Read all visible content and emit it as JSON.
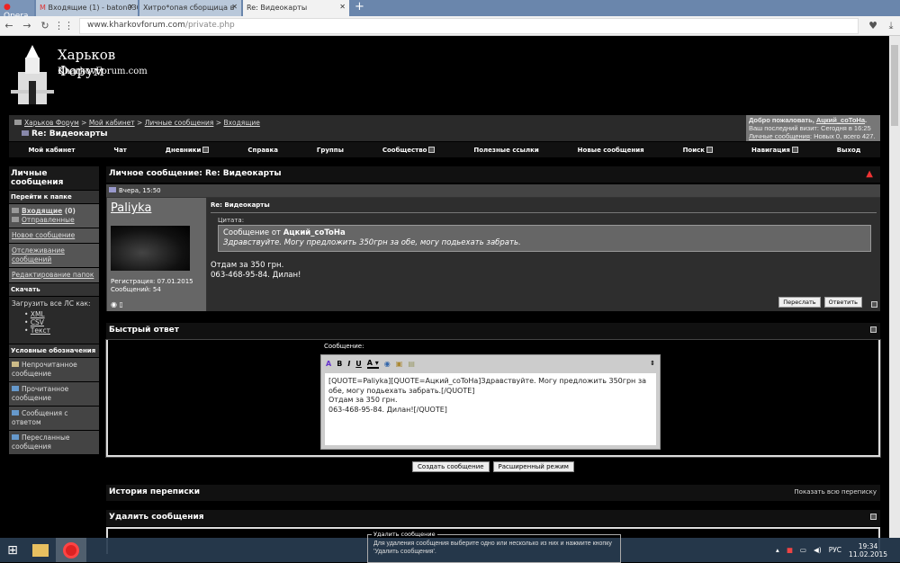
{
  "browser": {
    "opera_label": "Opera",
    "tabs": [
      {
        "label": "Входящие (1) - baton030"
      },
      {
        "label": "Хитро*опая сборщица в"
      },
      {
        "label": "Re: Видеокарты"
      }
    ],
    "url_host": "www.kharkovforum.com",
    "url_path": "/private.php"
  },
  "logo": {
    "title": "Харьков Форум",
    "subtitle": "KharkovForum.com"
  },
  "breadcrumb": {
    "items": [
      "Харьков Форум",
      "Мой кабинет",
      "Личные сообщения",
      "Входящие"
    ],
    "sep": " > ",
    "title": "Re: Видеокарты"
  },
  "welcome": {
    "line1": "Добро пожаловать, ",
    "user": "Ацкий_coToHa",
    "line1_end": ".",
    "line2": "Ваш последний визит: Сегодня в 16:25",
    "pm_link": "Личные сообщения",
    "line3": ": Новых 0, всего 427."
  },
  "nav": [
    "Мой кабинет",
    "Чат",
    "Дневники",
    "Справка",
    "Группы",
    "Сообщество",
    "Полезные ссылки",
    "Новые сообщения",
    "Поиск",
    "Навигация",
    "Выход"
  ],
  "sidebar": {
    "title": "Личные сообщения",
    "goto_folder": "Перейти к папке",
    "inbox": "Входящие",
    "inbox_count": " (0)",
    "sent": "Отправленные",
    "new_message": "Новое сообщение",
    "tracking": "Отслеживание сообщений",
    "edit_folders": "Редактирование папок",
    "download": "Скачать",
    "download_all": "Загрузить все ЛС как:",
    "formats": [
      "XML",
      "CSV",
      "Текст"
    ],
    "legend_title": "Условные обозначения",
    "legend": [
      "Непрочитанное сообщение",
      "Прочитанное сообщение",
      "Сообщения с ответом",
      "Пересланные сообщения"
    ]
  },
  "message": {
    "header": "Личное сообщение: Re: Видеокарты",
    "date": "Вчера, 15:50",
    "username": "Paliyka",
    "registration": "Регистрация: 07.01.2015",
    "posts": "Сообщений: 54",
    "title": "Re: Видеокарты",
    "quote_label": "Цитата:",
    "quote_from": "Сообщение от ",
    "quote_author": "Ацкий_coToHa",
    "quote_text": "Здравствуйте. Могу предложить 350грн за обе, могу подьехать забрать.",
    "body_line1": "Отдам за 350 грн.",
    "body_line2": "063-468-95-84. Дилан!",
    "forward": "Переслать",
    "reply": "Ответить"
  },
  "quick_reply": {
    "title": "Быстрый ответ",
    "label": "Сообщение:",
    "text": "[QUOTE=Paliyka][QUOTE=Ацкий_coToHa]Здравствуйте. Могу предложить 350грн за обе, могу подьехать забрать.[/QUOTE]\nОтдам за 350 грн.\n063-468-95-84. Дилан![/QUOTE]",
    "submit": "Создать сообщение",
    "advanced": "Расширенный режим"
  },
  "history": {
    "title": "История переписки",
    "show_all": "Показать всю переписку"
  },
  "delete": {
    "title": "Удалить сообщения",
    "legend": "Удалить сообщение",
    "text": "Для удаления сообщения выберите одно или несколько из них и нажмите кнопку 'Удалить сообщения'."
  },
  "taskbar": {
    "lang": "РУС",
    "time": "19:34",
    "date": "11.02.2015"
  }
}
